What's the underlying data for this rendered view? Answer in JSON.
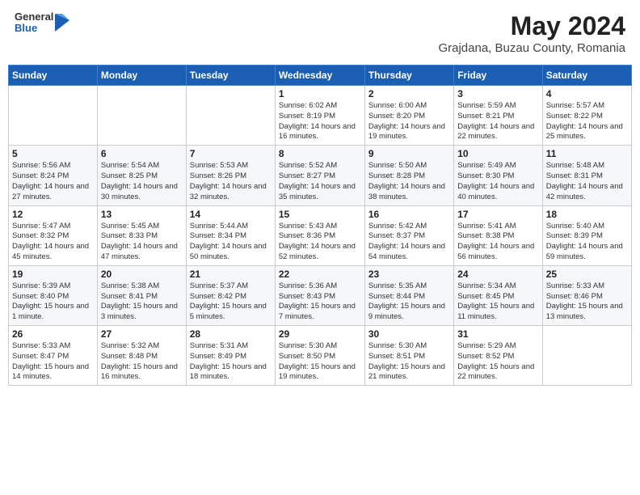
{
  "header": {
    "logo_general": "General",
    "logo_blue": "Blue",
    "month": "May 2024",
    "location": "Grajdana, Buzau County, Romania"
  },
  "weekdays": [
    "Sunday",
    "Monday",
    "Tuesday",
    "Wednesday",
    "Thursday",
    "Friday",
    "Saturday"
  ],
  "weeks": [
    [
      {
        "day": "",
        "text": ""
      },
      {
        "day": "",
        "text": ""
      },
      {
        "day": "",
        "text": ""
      },
      {
        "day": "1",
        "text": "Sunrise: 6:02 AM\nSunset: 8:19 PM\nDaylight: 14 hours and 16 minutes."
      },
      {
        "day": "2",
        "text": "Sunrise: 6:00 AM\nSunset: 8:20 PM\nDaylight: 14 hours and 19 minutes."
      },
      {
        "day": "3",
        "text": "Sunrise: 5:59 AM\nSunset: 8:21 PM\nDaylight: 14 hours and 22 minutes."
      },
      {
        "day": "4",
        "text": "Sunrise: 5:57 AM\nSunset: 8:22 PM\nDaylight: 14 hours and 25 minutes."
      }
    ],
    [
      {
        "day": "5",
        "text": "Sunrise: 5:56 AM\nSunset: 8:24 PM\nDaylight: 14 hours and 27 minutes."
      },
      {
        "day": "6",
        "text": "Sunrise: 5:54 AM\nSunset: 8:25 PM\nDaylight: 14 hours and 30 minutes."
      },
      {
        "day": "7",
        "text": "Sunrise: 5:53 AM\nSunset: 8:26 PM\nDaylight: 14 hours and 32 minutes."
      },
      {
        "day": "8",
        "text": "Sunrise: 5:52 AM\nSunset: 8:27 PM\nDaylight: 14 hours and 35 minutes."
      },
      {
        "day": "9",
        "text": "Sunrise: 5:50 AM\nSunset: 8:28 PM\nDaylight: 14 hours and 38 minutes."
      },
      {
        "day": "10",
        "text": "Sunrise: 5:49 AM\nSunset: 8:30 PM\nDaylight: 14 hours and 40 minutes."
      },
      {
        "day": "11",
        "text": "Sunrise: 5:48 AM\nSunset: 8:31 PM\nDaylight: 14 hours and 42 minutes."
      }
    ],
    [
      {
        "day": "12",
        "text": "Sunrise: 5:47 AM\nSunset: 8:32 PM\nDaylight: 14 hours and 45 minutes."
      },
      {
        "day": "13",
        "text": "Sunrise: 5:45 AM\nSunset: 8:33 PM\nDaylight: 14 hours and 47 minutes."
      },
      {
        "day": "14",
        "text": "Sunrise: 5:44 AM\nSunset: 8:34 PM\nDaylight: 14 hours and 50 minutes."
      },
      {
        "day": "15",
        "text": "Sunrise: 5:43 AM\nSunset: 8:36 PM\nDaylight: 14 hours and 52 minutes."
      },
      {
        "day": "16",
        "text": "Sunrise: 5:42 AM\nSunset: 8:37 PM\nDaylight: 14 hours and 54 minutes."
      },
      {
        "day": "17",
        "text": "Sunrise: 5:41 AM\nSunset: 8:38 PM\nDaylight: 14 hours and 56 minutes."
      },
      {
        "day": "18",
        "text": "Sunrise: 5:40 AM\nSunset: 8:39 PM\nDaylight: 14 hours and 59 minutes."
      }
    ],
    [
      {
        "day": "19",
        "text": "Sunrise: 5:39 AM\nSunset: 8:40 PM\nDaylight: 15 hours and 1 minute."
      },
      {
        "day": "20",
        "text": "Sunrise: 5:38 AM\nSunset: 8:41 PM\nDaylight: 15 hours and 3 minutes."
      },
      {
        "day": "21",
        "text": "Sunrise: 5:37 AM\nSunset: 8:42 PM\nDaylight: 15 hours and 5 minutes."
      },
      {
        "day": "22",
        "text": "Sunrise: 5:36 AM\nSunset: 8:43 PM\nDaylight: 15 hours and 7 minutes."
      },
      {
        "day": "23",
        "text": "Sunrise: 5:35 AM\nSunset: 8:44 PM\nDaylight: 15 hours and 9 minutes."
      },
      {
        "day": "24",
        "text": "Sunrise: 5:34 AM\nSunset: 8:45 PM\nDaylight: 15 hours and 11 minutes."
      },
      {
        "day": "25",
        "text": "Sunrise: 5:33 AM\nSunset: 8:46 PM\nDaylight: 15 hours and 13 minutes."
      }
    ],
    [
      {
        "day": "26",
        "text": "Sunrise: 5:33 AM\nSunset: 8:47 PM\nDaylight: 15 hours and 14 minutes."
      },
      {
        "day": "27",
        "text": "Sunrise: 5:32 AM\nSunset: 8:48 PM\nDaylight: 15 hours and 16 minutes."
      },
      {
        "day": "28",
        "text": "Sunrise: 5:31 AM\nSunset: 8:49 PM\nDaylight: 15 hours and 18 minutes."
      },
      {
        "day": "29",
        "text": "Sunrise: 5:30 AM\nSunset: 8:50 PM\nDaylight: 15 hours and 19 minutes."
      },
      {
        "day": "30",
        "text": "Sunrise: 5:30 AM\nSunset: 8:51 PM\nDaylight: 15 hours and 21 minutes."
      },
      {
        "day": "31",
        "text": "Sunrise: 5:29 AM\nSunset: 8:52 PM\nDaylight: 15 hours and 22 minutes."
      },
      {
        "day": "",
        "text": ""
      }
    ]
  ]
}
